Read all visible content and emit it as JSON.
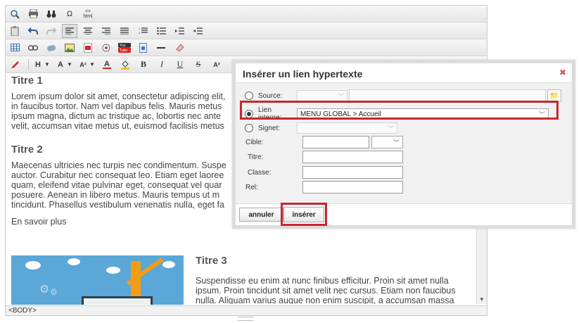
{
  "toolbar": {
    "row1": [
      "search-icon",
      "print-icon",
      "binoculars-icon",
      "omega-icon",
      "html-icon"
    ],
    "omega": "Ω",
    "html": "html",
    "heading_label": "H",
    "font_label": "A",
    "size_label": "A²",
    "color_label": "A",
    "bold": "B",
    "italic": "I",
    "underline": "U",
    "strike": "S",
    "superscript": "A²"
  },
  "content": {
    "title1": "Titre 1",
    "para1": "Lorem ipsum dolor sit amet, consectetur adipiscing elit, in faucibus tortor. Nam vel dapibus felis. Mauris metus ipsum magna, dictum ac tristique ac, lobortis nec ante velit, accumsan vitae metus ut, euismod facilisis metus",
    "title2": "Titre 2",
    "para2": "Maecenas ultricies nec turpis nec condimentum. Suspe auctor. Curabitur nec consequat leo. Etiam eget laoree quam, eleifend vitae pulvinar eget, consequat vel quar posuere. Aenean in libero metus. Mauris tempus ut m tincidunt. Phasellus vestibulum venenatis nulla, eget fa",
    "more": "En savoir plus",
    "title3": "Titre 3",
    "para3": "Suspendisse eu enim at nunc finibus efficitur. Proin sit amet nulla ipsum. Proin tincidunt sit amet velit nec cursus. Etiam non faucibus nulla. Aliquam varius augue non enim suscipit, a accumsan massa"
  },
  "statusbar": {
    "path": "<BODY>"
  },
  "modal": {
    "title": "Insérer un lien hypertexte",
    "source_label": "Source:",
    "internal_label": "Lien interne:",
    "internal_value": "MENU GLOBAL > Accueil",
    "anchor_label": "Signet:",
    "target_label": "Cible:",
    "title_label": "Titre:",
    "class_label": "Classe:",
    "rel_label": "Rel:",
    "cancel": "annuler",
    "insert": "insérer"
  },
  "colors": {
    "highlight": "#c9262c",
    "close": "#d9534f",
    "link": "#1a5fa0"
  }
}
